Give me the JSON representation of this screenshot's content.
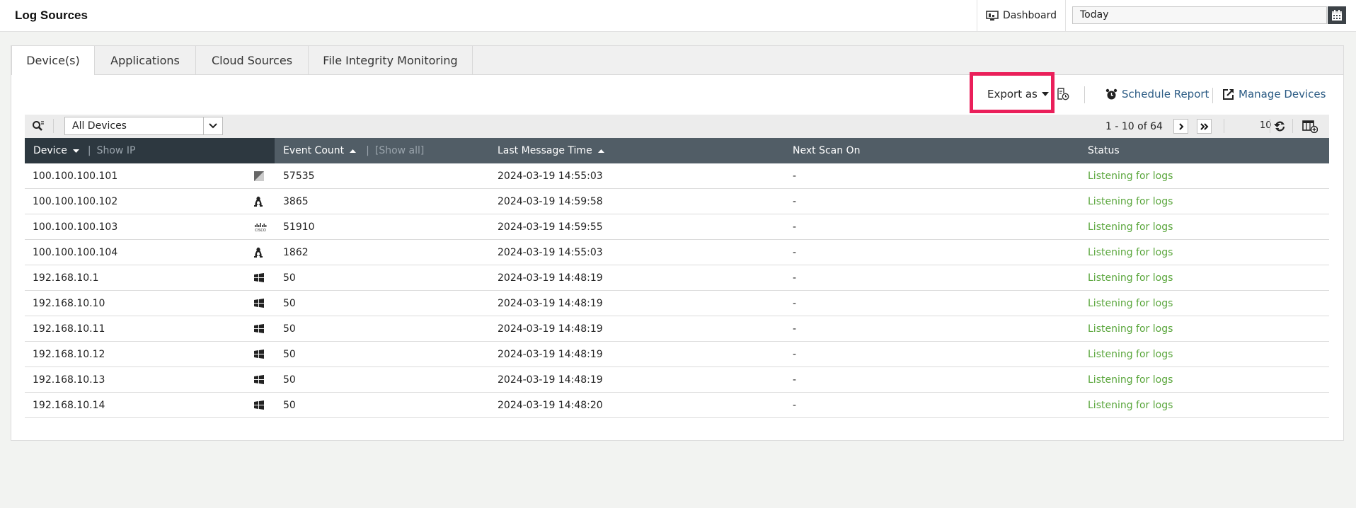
{
  "header": {
    "title": "Log Sources",
    "dashboard_label": "Dashboard",
    "date_value": "Today"
  },
  "tabs": [
    {
      "label": "Device(s)",
      "active": true
    },
    {
      "label": "Applications",
      "active": false
    },
    {
      "label": "Cloud Sources",
      "active": false
    },
    {
      "label": "File Integrity Monitoring",
      "active": false
    }
  ],
  "toolbar": {
    "export_label": "Export as",
    "schedule_label": "Schedule Report",
    "manage_label": "Manage Devices"
  },
  "filter": {
    "device_filter_value": "All Devices",
    "pager_text": "1 - 10 of 64",
    "per_page": "10"
  },
  "table": {
    "columns": {
      "device": "Device",
      "show_ip": "Show IP",
      "event_count": "Event Count",
      "show_all": "[Show all]",
      "last_message": "Last Message Time",
      "next_scan": "Next Scan On",
      "status": "Status"
    },
    "rows": [
      {
        "device": "100.100.100.101",
        "os": "generic",
        "count": "57535",
        "time": "2024-03-19 14:55:03",
        "scan": "-",
        "status": "Listening for logs"
      },
      {
        "device": "100.100.100.102",
        "os": "linux",
        "count": "3865",
        "time": "2024-03-19 14:59:58",
        "scan": "-",
        "status": "Listening for logs"
      },
      {
        "device": "100.100.100.103",
        "os": "cisco",
        "count": "51910",
        "time": "2024-03-19 14:59:55",
        "scan": "-",
        "status": "Listening for logs"
      },
      {
        "device": "100.100.100.104",
        "os": "linux",
        "count": "1862",
        "time": "2024-03-19 14:55:03",
        "scan": "-",
        "status": "Listening for logs"
      },
      {
        "device": "192.168.10.1",
        "os": "windows",
        "count": "50",
        "time": "2024-03-19 14:48:19",
        "scan": "-",
        "status": "Listening for logs"
      },
      {
        "device": "192.168.10.10",
        "os": "windows",
        "count": "50",
        "time": "2024-03-19 14:48:19",
        "scan": "-",
        "status": "Listening for logs"
      },
      {
        "device": "192.168.10.11",
        "os": "windows",
        "count": "50",
        "time": "2024-03-19 14:48:19",
        "scan": "-",
        "status": "Listening for logs"
      },
      {
        "device": "192.168.10.12",
        "os": "windows",
        "count": "50",
        "time": "2024-03-19 14:48:19",
        "scan": "-",
        "status": "Listening for logs"
      },
      {
        "device": "192.168.10.13",
        "os": "windows",
        "count": "50",
        "time": "2024-03-19 14:48:19",
        "scan": "-",
        "status": "Listening for logs"
      },
      {
        "device": "192.168.10.14",
        "os": "windows",
        "count": "50",
        "time": "2024-03-19 14:48:20",
        "scan": "-",
        "status": "Listening for logs"
      }
    ]
  },
  "colors": {
    "status_green": "#5aa63c",
    "link_blue": "#2b5b84",
    "header_dark": "#2d3840",
    "header_mid": "#515d66",
    "highlight": "#ea1f5a"
  }
}
